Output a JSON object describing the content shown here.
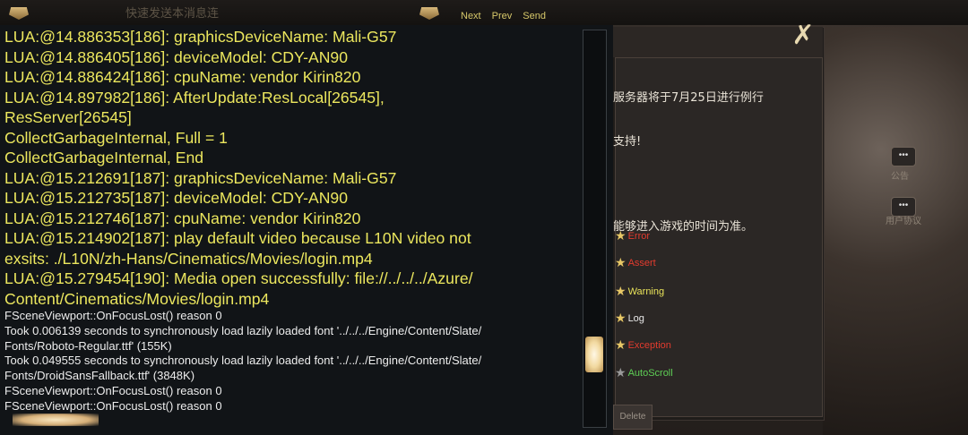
{
  "top_bar": {
    "faded_text": "快速发送本消息连",
    "nav": {
      "next": "Next",
      "prev": "Prev",
      "send": "Send"
    }
  },
  "notice": {
    "close_glyph": "✗",
    "lines": [
      "服务器将于7月25日进行例行",
      "支持!",
      "能够进入游戏的时间为准。"
    ]
  },
  "side_icons": [
    {
      "name": "announcement",
      "glyph": "•••",
      "label": "公告"
    },
    {
      "name": "user-agreement",
      "glyph": "•••",
      "label": "用户协议"
    }
  ],
  "filters": [
    {
      "label": "Error",
      "color": "#e23b2e",
      "star_color": "#e8c866"
    },
    {
      "label": "Assert",
      "color": "#e23b2e",
      "star_color": "#e8c866"
    },
    {
      "label": "Warning",
      "color": "#e9e35a",
      "star_color": "#e8c866"
    },
    {
      "label": "Log",
      "color": "#e8e8e8",
      "star_color": "#e8c866"
    },
    {
      "label": "Exception",
      "color": "#e23b2e",
      "star_color": "#e8c866"
    },
    {
      "label": "AutoScroll",
      "color": "#5ecf55",
      "star_color": "#9a9a9a"
    }
  ],
  "delete_label": "Delete",
  "console": {
    "lua_lines": [
      "LUA:@14.886353[186]: graphicsDeviceName:  Mali-G57",
      "LUA:@14.886405[186]: deviceModel:  CDY-AN90",
      "LUA:@14.886424[186]: cpuName:   vendor Kirin820",
      "LUA:@14.897982[186]: AfterUpdate:ResLocal[26545],",
      "ResServer[26545]",
      "CollectGarbageInternal, Full = 1",
      "CollectGarbageInternal, End",
      "LUA:@15.212691[187]: graphicsDeviceName:  Mali-G57",
      "LUA:@15.212735[187]: deviceModel:  CDY-AN90",
      "LUA:@15.212746[187]: cpuName:   vendor Kirin820",
      "LUA:@15.214902[187]: play default video because L10N video not",
      "exsits:  ./L10N/zh-Hans/Cinematics/Movies/login.mp4",
      "LUA:@15.279454[190]: Media open successfully:   file://../../../Azure/",
      "Content/Cinematics/Movies/login.mp4"
    ],
    "plain_lines": [
      "FSceneViewport::OnFocusLost() reason 0",
      "Took 0.006139 seconds to synchronously load lazily loaded font '../../../Engine/Content/Slate/",
      "Fonts/Roboto-Regular.ttf' (155K)",
      "Took 0.049555 seconds to synchronously load lazily loaded font '../../../Engine/Content/Slate/",
      "Fonts/DroidSansFallback.ttf' (3848K)",
      "FSceneViewport::OnFocusLost() reason 0",
      "FSceneViewport::OnFocusLost() reason 0"
    ]
  }
}
